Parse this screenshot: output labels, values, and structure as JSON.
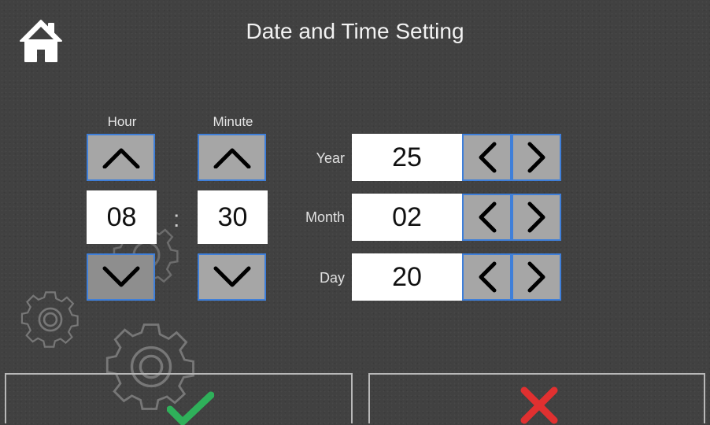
{
  "header": {
    "title": "Date and Time Setting",
    "home_icon": "home-icon"
  },
  "time": {
    "hour_label": "Hour",
    "minute_label": "Minute",
    "hour_value": "08",
    "minute_value": "30",
    "separator": ":",
    "up_icon": "chevron-up-icon",
    "down_icon": "chevron-down-icon"
  },
  "date": {
    "rows": [
      {
        "label": "Year",
        "value": "25"
      },
      {
        "label": "Month",
        "value": "02"
      },
      {
        "label": "Day",
        "value": "20"
      }
    ],
    "decrement_icon": "chevron-left-icon",
    "increment_icon": "chevron-right-icon"
  },
  "footer": {
    "confirm_icon": "checkmark-icon",
    "cancel_icon": "cross-icon"
  },
  "colors": {
    "background": "#414141",
    "button_fill": "#a6a6a6",
    "button_border": "#3f7fd9",
    "confirm": "#2fb05a",
    "cancel": "#e03030"
  }
}
